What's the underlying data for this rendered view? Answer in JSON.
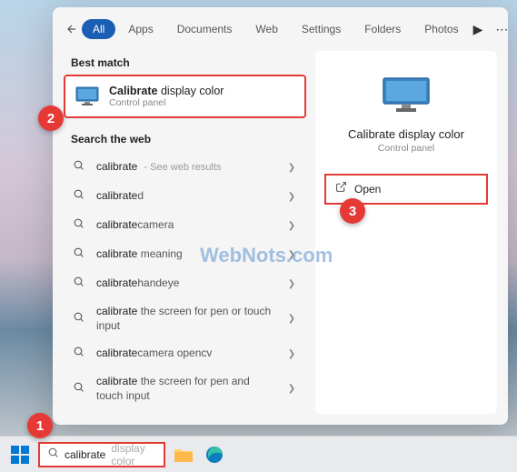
{
  "tabs": [
    "All",
    "Apps",
    "Documents",
    "Web",
    "Settings",
    "Folders",
    "Photos"
  ],
  "sections": {
    "best_match": "Best match",
    "search_web": "Search the web"
  },
  "best_match": {
    "title_bold": "Calibrate",
    "title_rest": " display color",
    "sub": "Control panel"
  },
  "web_results": [
    {
      "bold": "calibrate",
      "rest": "",
      "hint": " - See web results"
    },
    {
      "bold": "calibrate",
      "rest": "d",
      "hint": ""
    },
    {
      "bold": "calibrate",
      "rest": "camera",
      "hint": ""
    },
    {
      "bold": "calibrate",
      "rest": " meaning",
      "hint": ""
    },
    {
      "bold": "calibrate",
      "rest": "handeye",
      "hint": ""
    },
    {
      "bold": "calibrate",
      "rest": " the screen for pen or touch input",
      "hint": ""
    },
    {
      "bold": "calibrate",
      "rest": "camera opencv",
      "hint": ""
    },
    {
      "bold": "calibrate",
      "rest": " the screen for pen and touch input",
      "hint": ""
    }
  ],
  "right_panel": {
    "title": "Calibrate display color",
    "sub": "Control panel",
    "open": "Open"
  },
  "search_input": {
    "typed": "calibrate",
    "ghost": " display color"
  },
  "watermark": "WebNots.com",
  "callouts": {
    "c1": "1",
    "c2": "2",
    "c3": "3"
  }
}
